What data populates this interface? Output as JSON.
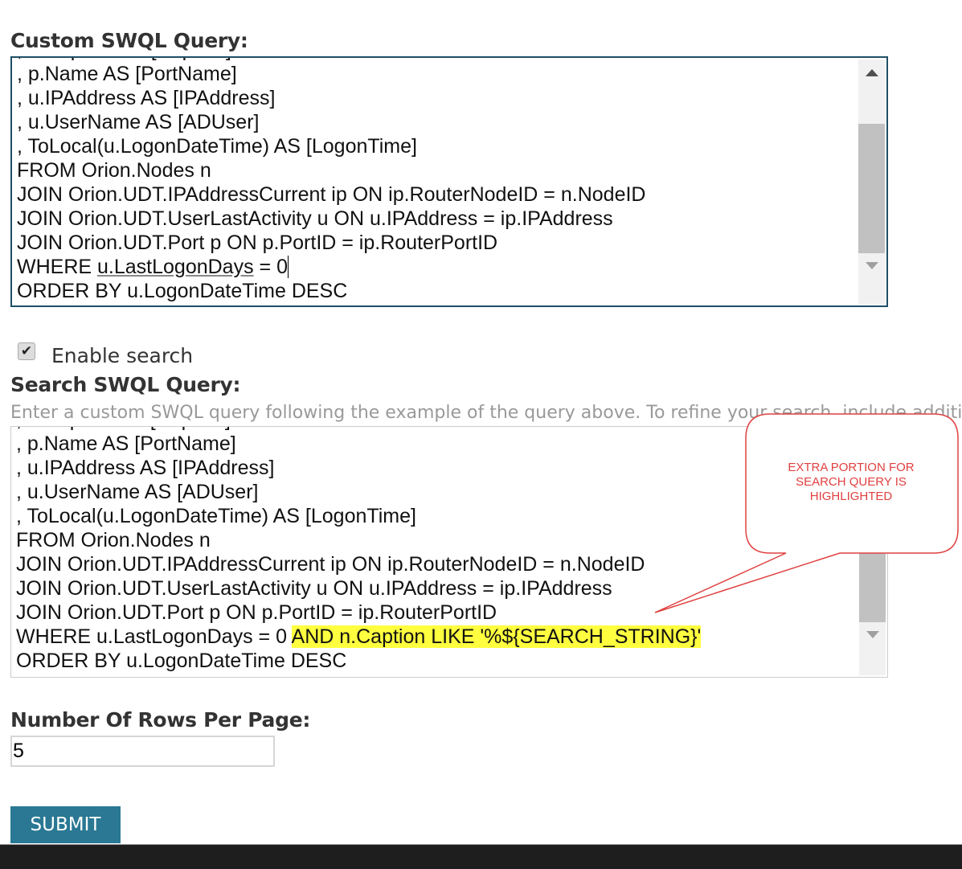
{
  "custom_query": {
    "label": "Custom SWQL Query:",
    "lines": [
      ", n.Caption AS [Caption]",
      ", p.Name AS [PortName]",
      ", u.IPAddress AS [IPAddress]",
      ", u.UserName AS [ADUser]",
      ", ToLocal(u.LogonDateTime) AS [LogonTime]",
      "FROM Orion.Nodes n",
      "JOIN Orion.UDT.IPAddressCurrent ip ON ip.RouterNodeID = n.NodeID",
      "JOIN Orion.UDT.UserLastActivity u ON u.IPAddress = ip.IPAddress",
      "JOIN Orion.UDT.Port p ON p.PortID = ip.RouterPortID"
    ],
    "where_prefix": "WHERE ",
    "where_underlined": "u.LastLogonDays",
    "where_rest": " = 0",
    "order": "ORDER BY u.LogonDateTime DESC"
  },
  "enable_search": {
    "label": "Enable search",
    "checked": true
  },
  "search_query": {
    "label": "Search SWQL Query:",
    "hint": "Enter a custom SWQL query following the example of the query above. To refine your search, include additional",
    "lines": [
      ", n.Caption AS [Caption]",
      ", p.Name AS [PortName]",
      ", u.IPAddress AS [IPAddress]",
      ", u.UserName AS [ADUser]",
      ", ToLocal(u.LogonDateTime) AS [LogonTime]",
      "FROM Orion.Nodes n",
      "JOIN Orion.UDT.IPAddressCurrent ip ON ip.RouterNodeID = n.NodeID",
      "JOIN Orion.UDT.UserLastActivity u ON u.IPAddress = ip.IPAddress",
      "JOIN Orion.UDT.Port p ON p.PortID = ip.RouterPortID"
    ],
    "where": "WHERE u.LastLogonDays = 0 ",
    "highlight": "AND n.Caption LIKE '%${SEARCH_STRING}'",
    "order": "ORDER BY u.LogonDateTime DESC"
  },
  "callout": {
    "text": "EXTRA PORTION FOR SEARCH QUERY IS HIGHLIGHTED",
    "color": "#e04040"
  },
  "rows_per_page": {
    "label": "Number Of Rows Per Page:",
    "value": "5"
  },
  "submit": {
    "label": "SUBMIT",
    "color": "#2a7893"
  },
  "colors": {
    "highlight": "#ffff40",
    "footer": "#1e1e1e"
  }
}
